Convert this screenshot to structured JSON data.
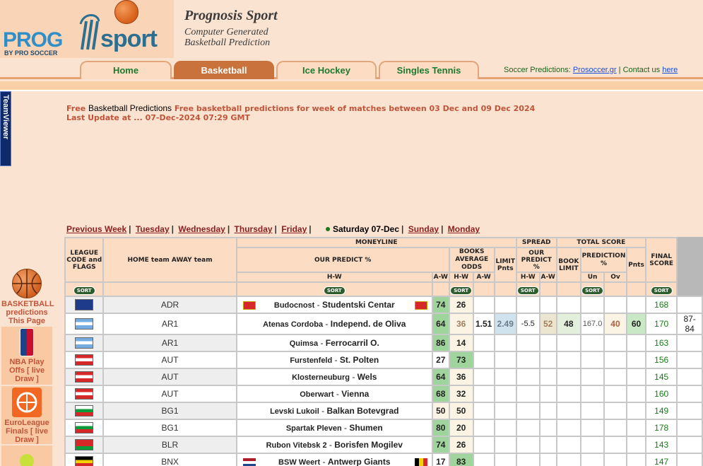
{
  "header": {
    "logo_text_prog": "PROG",
    "logo_text_sport": "sport",
    "logo_byline": "BY PRO SOCCER",
    "title": "Prognosis Sport",
    "subtitle1": "Computer Generated",
    "subtitle2": "Basketball Prediction"
  },
  "nav": {
    "tabs": [
      "Home",
      "Basketball",
      "Ice Hockey",
      "Singles Tennis"
    ],
    "soccer_label": "Soccer Predictions:",
    "soccer_link": "Prosoccer.gr",
    "contact_label": "Contact us",
    "contact_link": "here"
  },
  "teamviewer": "TeamViewer",
  "intro": {
    "free": "Free",
    "bp": "Basketball Predictions",
    "text": "Free basketball predictions for week of matches between 03 Dec and 09 Dec 2024",
    "update": "Last Update at ...  07-Dec-2024 07:29 GMT"
  },
  "weeknav": {
    "prev": "Previous Week",
    "tue": "Tuesday",
    "wed": "Wednesday",
    "thu": "Thursday",
    "fri": "Friday",
    "current": "Saturday 07-Dec",
    "sun": "Sunday",
    "mon": "Monday"
  },
  "sidebar": {
    "basketball": "BASKETBALL predictions This Page",
    "nba": "NBA Play Offs [ live Draw ]",
    "euroleague": "EuroLeague Finals [ live Draw ]"
  },
  "table": {
    "h_league": "LEAGUE CODE and FLAGS",
    "h_teams": "HOME team    AWAY team",
    "h_moneyline": "MONEYLINE",
    "h_our_predict": "OUR PREDICT %",
    "h_books_avg": "BOOKS AVERAGE",
    "h_odds": "ODDS",
    "h_limit": "LIMIT Pnts",
    "h_spread": "SPREAD",
    "h_total": "TOTAL SCORE",
    "h_book_limit": "BOOK LIMIT",
    "h_prediction": "PREDICTION",
    "h_pct": "%",
    "h_un": "Un",
    "h_ov": "Ov",
    "h_pnts": "Pnts",
    "h_final": "FINAL SCORE",
    "h_hw": "H-W",
    "h_aw": "A-W",
    "sort": "SORT",
    "rows": [
      {
        "code": "ADR",
        "home": "Budocnost",
        "away": "Studentski Centar",
        "ph": "74",
        "pa": "26",
        "oh": "",
        "oa": "",
        "lim": "",
        "sh": "",
        "sa": "",
        "bl": "",
        "un": "",
        "ov": "",
        "pn": "168",
        "fs": ""
      },
      {
        "code": "AR1",
        "home": "Atenas Cordoba",
        "away": "Independ. de Oliva",
        "ph": "64",
        "pa": "36",
        "oh": "1.51",
        "oa": "2.49",
        "lim": "-5.5",
        "sh": "52",
        "sa": "48",
        "bl": "167.0",
        "un": "40",
        "ov": "60",
        "pn": "170",
        "fs": "87- 84"
      },
      {
        "code": "AR1",
        "home": "Quimsa",
        "away": "Ferrocarril O.",
        "ph": "86",
        "pa": "14",
        "oh": "",
        "oa": "",
        "lim": "",
        "sh": "",
        "sa": "",
        "bl": "",
        "un": "",
        "ov": "",
        "pn": "163",
        "fs": ""
      },
      {
        "code": "AUT",
        "home": "Furstenfeld",
        "away": "St. Polten",
        "ph": "27",
        "pa": "73",
        "oh": "",
        "oa": "",
        "lim": "",
        "sh": "",
        "sa": "",
        "bl": "",
        "un": "",
        "ov": "",
        "pn": "156",
        "fs": ""
      },
      {
        "code": "AUT",
        "home": "Klosterneuburg",
        "away": "Wels",
        "ph": "64",
        "pa": "36",
        "oh": "",
        "oa": "",
        "lim": "",
        "sh": "",
        "sa": "",
        "bl": "",
        "un": "",
        "ov": "",
        "pn": "145",
        "fs": ""
      },
      {
        "code": "AUT",
        "home": "Oberwart",
        "away": "Vienna",
        "ph": "68",
        "pa": "32",
        "oh": "",
        "oa": "",
        "lim": "",
        "sh": "",
        "sa": "",
        "bl": "",
        "un": "",
        "ov": "",
        "pn": "160",
        "fs": ""
      },
      {
        "code": "BG1",
        "home": "Levski Lukoil",
        "away": "Balkan Botevgrad",
        "ph": "50",
        "pa": "50",
        "oh": "",
        "oa": "",
        "lim": "",
        "sh": "",
        "sa": "",
        "bl": "",
        "un": "",
        "ov": "",
        "pn": "149",
        "fs": ""
      },
      {
        "code": "BG1",
        "home": "Spartak Pleven",
        "away": "Shumen",
        "ph": "80",
        "pa": "20",
        "oh": "",
        "oa": "",
        "lim": "",
        "sh": "",
        "sa": "",
        "bl": "",
        "un": "",
        "ov": "",
        "pn": "178",
        "fs": ""
      },
      {
        "code": "BLR",
        "home": "Rubon Vitebsk 2",
        "away": "Borisfen Mogilev",
        "ph": "74",
        "pa": "26",
        "oh": "",
        "oa": "",
        "lim": "",
        "sh": "",
        "sa": "",
        "bl": "",
        "un": "",
        "ov": "",
        "pn": "143",
        "fs": ""
      },
      {
        "code": "BNX",
        "home": "BSW Weert",
        "away": "Antwerp Giants",
        "ph": "17",
        "pa": "83",
        "oh": "",
        "oa": "",
        "lim": "",
        "sh": "",
        "sa": "",
        "bl": "",
        "un": "",
        "ov": "",
        "pn": "147",
        "fs": ""
      }
    ]
  }
}
